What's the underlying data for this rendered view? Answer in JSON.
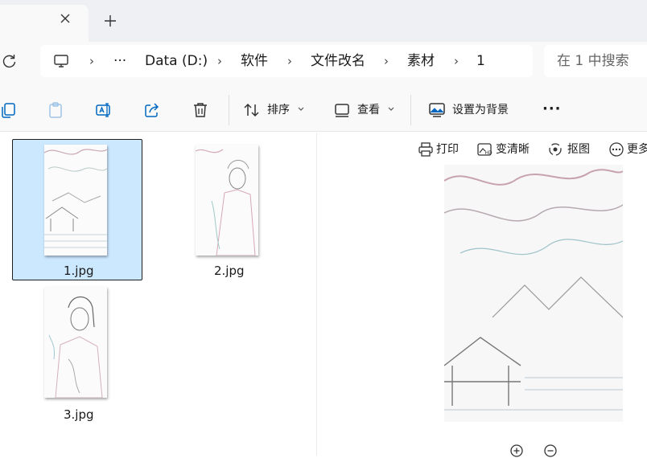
{
  "address": {
    "more_label": "···",
    "crumbs": [
      "Data (D:)",
      "软件",
      "文件改名",
      "素材",
      "1"
    ]
  },
  "search": {
    "placeholder": "在 1 中搜索"
  },
  "toolbar": {
    "sort_label": "排序",
    "view_label": "查看",
    "set_background_label": "设置为背景",
    "more_label": "···"
  },
  "files": [
    {
      "name": "1.jpg",
      "selected": true
    },
    {
      "name": "2.jpg",
      "selected": false
    },
    {
      "name": "3.jpg",
      "selected": false
    }
  ],
  "preview": {
    "print_label": "打印",
    "sharpen_label": "变清晰",
    "cutout_label": "抠图",
    "more_label": "更多"
  },
  "colors": {
    "selection": "#cce8ff",
    "accent": "#0067c0"
  }
}
